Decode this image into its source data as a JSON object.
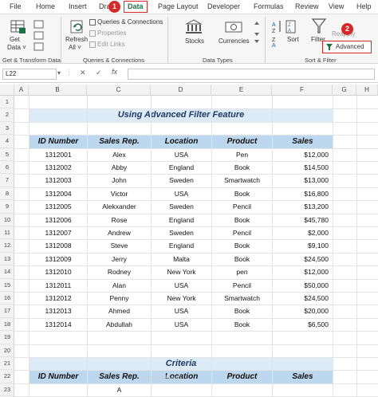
{
  "ribbon": {
    "tabs": [
      "File",
      "Home",
      "Insert",
      "Dra",
      "Data",
      "Page Layout",
      "Developer",
      "Formulas",
      "Review",
      "View",
      "Help"
    ],
    "active_tab": "Data",
    "groups": {
      "get_transform": {
        "name": "Get & Transform Data",
        "get_data_label_1": "Get",
        "get_data_label_2": "Data ˅"
      },
      "queries": {
        "name": "Queries & Connections",
        "refresh_label_1": "Refresh",
        "refresh_label_2": "All ˅",
        "queries_connections": "Queries & Connections",
        "properties": "Properties",
        "edit_links": "Edit Links"
      },
      "data_types": {
        "name": "Data Types",
        "stocks": "Stocks",
        "currencies": "Currencies"
      },
      "sort_filter": {
        "name": "Sort & Filter",
        "sort": "Sort",
        "filter": "Filter",
        "reapply": "Reapply",
        "advanced": "Advanced"
      }
    },
    "badges": [
      "1",
      "2"
    ]
  },
  "formula_bar": {
    "name_box": "L22",
    "cancel_symbol": "✕",
    "enter_symbol": "✓",
    "fx_symbol": "fx"
  },
  "sheet": {
    "columns": [
      "A",
      "B",
      "C",
      "D",
      "E",
      "F",
      "G",
      "H"
    ],
    "rows": [
      "1",
      "2",
      "3",
      "4",
      "5",
      "6",
      "7",
      "8",
      "9",
      "10",
      "11",
      "12",
      "13",
      "14",
      "15",
      "16",
      "17",
      "18",
      "19",
      "20",
      "21",
      "22",
      "23"
    ],
    "title": "Using Advanced Filter Feature",
    "headers": [
      "ID Number",
      "Sales Rep.",
      "Location",
      "Product",
      "Sales"
    ],
    "data": [
      [
        "1312001",
        "Alex",
        "USA",
        "Pen",
        "$12,000"
      ],
      [
        "1312002",
        "Abby",
        "England",
        "Book",
        "$14,500"
      ],
      [
        "1312003",
        "John",
        "Sweden",
        "Smartwatch",
        "$13,000"
      ],
      [
        "1312004",
        "Victor",
        "USA",
        "Book",
        "$16,800"
      ],
      [
        "1312005",
        "Alekxander",
        "Sweden",
        "Pencil",
        "$13,200"
      ],
      [
        "1312006",
        "Rose",
        "England",
        "Book",
        "$45,780"
      ],
      [
        "1312007",
        "Andrew",
        "Sweden",
        "Pencil",
        "$2,000"
      ],
      [
        "1312008",
        "Steve",
        "England",
        "Book",
        "$9,100"
      ],
      [
        "1312009",
        "Jerry",
        "Malta",
        "Book",
        "$24,500"
      ],
      [
        "1312010",
        "Rodney",
        "New York",
        "pen",
        "$12,000"
      ],
      [
        "1312011",
        "Alan",
        "USA",
        "Pencil",
        "$50,000"
      ],
      [
        "1312012",
        "Penny",
        "New York",
        "Smartwatch",
        "$24,500"
      ],
      [
        "1312013",
        "Ahmed",
        "USA",
        "Book",
        "$20,000"
      ],
      [
        "1312014",
        "Abdullah",
        "USA",
        "Book",
        "$6,500"
      ]
    ],
    "criteria_title": "Criteria",
    "criteria_headers": [
      "ID Number",
      "Sales Rep.",
      "Location",
      "Product",
      "Sales"
    ],
    "criteria_row": [
      "",
      "A",
      "",
      "",
      ""
    ]
  },
  "watermark": "exceldemy"
}
